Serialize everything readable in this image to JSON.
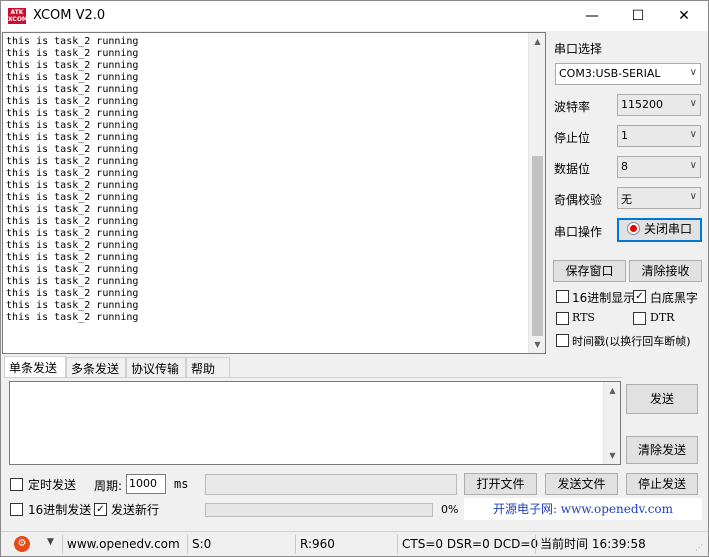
{
  "window": {
    "title": "XCOM V2.0",
    "icon_text_top": "ATK",
    "icon_text_bottom": "XCOM",
    "controls": {
      "minimize": "—",
      "maximize": "☐",
      "close": "✕"
    }
  },
  "receive": {
    "lines": [
      "this is task_2 running",
      "this is task_2 running",
      "this is task_2 running",
      "this is task_2 running",
      "this is task_2 running",
      "this is task_2 running",
      "this is task_2 running",
      "this is task_2 running",
      "this is task_2 running",
      "this is task_2 running",
      "this is task_2 running",
      "this is task_2 running",
      "this is task_2 running",
      "this is task_2 running",
      "this is task_2 running",
      "this is task_2 running",
      "this is task_2 running",
      "this is task_2 running",
      "this is task_2 running",
      "this is task_2 running",
      "this is task_2 running",
      "this is task_2 running",
      "this is task_2 running",
      "this is task_2 running"
    ],
    "scroll_position": 1.0
  },
  "serial": {
    "port_select_label": "串口选择",
    "port_value": "COM3:USB-SERIAL",
    "baud_label": "波特率",
    "baud_value": "115200",
    "stop_bits_label": "停止位",
    "stop_bits_value": "1",
    "data_bits_label": "数据位",
    "data_bits_value": "8",
    "parity_label": "奇偶校验",
    "parity_value": "无",
    "operation_label": "串口操作",
    "close_port_button": "关闭串口"
  },
  "receive_controls": {
    "save_window_button": "保存窗口",
    "clear_receive_button": "清除接收",
    "hex_display": {
      "label": "16进制显示",
      "checked": false
    },
    "white_bg_black_text": {
      "label": "白底黑字",
      "checked": true
    },
    "rts": {
      "label": "RTS",
      "checked": false
    },
    "dtr": {
      "label": "DTR",
      "checked": false
    },
    "timestamp": {
      "label": "时间戳(以换行回车断帧)",
      "checked": false
    }
  },
  "tabs": [
    "单条发送",
    "多条发送",
    "协议传输",
    "帮助"
  ],
  "send": {
    "send_button": "发送",
    "clear_send_button": "清除发送",
    "timed_send": {
      "label": "定时发送",
      "checked": false
    },
    "period_label": "周期:",
    "period_value": "1000",
    "period_unit": "ms",
    "open_file_button": "打开文件",
    "send_file_button": "发送文件",
    "stop_send_button": "停止发送",
    "hex_send": {
      "label": "16进制发送",
      "checked": false
    },
    "send_newline": {
      "label": "发送新行",
      "checked": true
    },
    "progress_text": "0%",
    "progress": 0
  },
  "ad_link": "开源电子网: www.openedv.com",
  "statusbar": {
    "website": "www.openedv.com",
    "sent": "S:0",
    "received": "R:960",
    "signals": "CTS=0 DSR=0 DCD=0",
    "time_label": "当前时间",
    "time_value": "16:39:58"
  },
  "icons": {
    "chevron": "chevron-down-icon",
    "check": "✓",
    "scroll_up": "▲",
    "scroll_down": "▼",
    "status_arrow": "▼"
  },
  "colors": {
    "accent_focus": "#0078d7",
    "record_dot": "#e00000",
    "link": "#1f3fbf",
    "app_icon": "#c8102e"
  }
}
